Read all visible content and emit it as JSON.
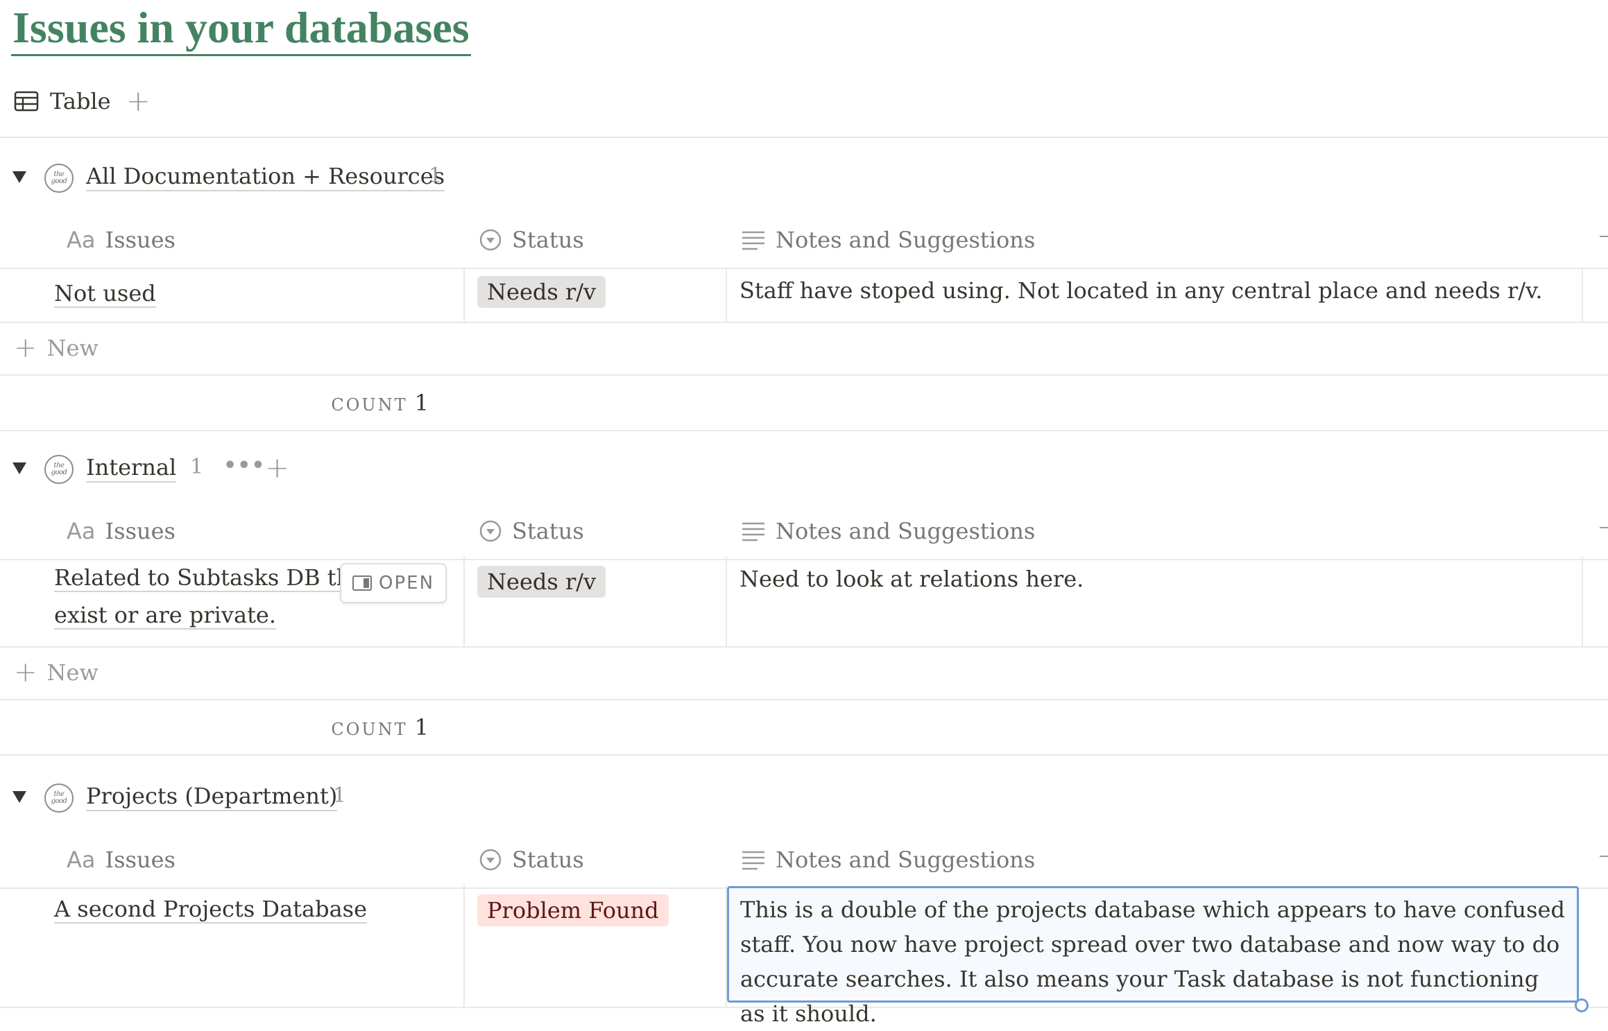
{
  "page": {
    "title": "Issues in your databases"
  },
  "view": {
    "tab_label": "Table",
    "add_label": "+"
  },
  "columns": {
    "issues": "Issues",
    "status": "Status",
    "notes": "Notes and Suggestions",
    "issues_icon": "Aa"
  },
  "groups": [
    {
      "name": "All Documentation + Resources",
      "count": "1",
      "rows": [
        {
          "issue": "Not used",
          "status": "Needs r/v",
          "notes": "Staff have stoped using. Not located in any central place and needs r/v."
        }
      ],
      "new_label": "New",
      "count_label": "COUNT",
      "count_value": "1"
    },
    {
      "name": "Internal",
      "count": "1",
      "more": "•••",
      "rows": [
        {
          "issue_line1": "Related to Subtasks DB that d",
          "issue_line2": "exist or are private.",
          "status": "Needs r/v",
          "notes": "Need to look at relations here.",
          "open_label": "OPEN"
        }
      ],
      "new_label": "New",
      "count_label": "COUNT",
      "count_value": "1"
    },
    {
      "name": "Projects (Department)",
      "count": "1",
      "rows": [
        {
          "issue": "A second Projects Database",
          "status": "Problem Found",
          "notes": "This is a double of the projects database which appears to have confused staff. You now have project spread over two database and now way to do accurate searches. It also means your Task database is not functioning as it should."
        }
      ]
    }
  ],
  "icons": {
    "group_icon": "thegood-logo-icon",
    "caret": "triangle-down-icon",
    "table": "table-icon",
    "status": "status-icon",
    "notes": "text-lines-icon",
    "plus": "plus-icon"
  },
  "colors": {
    "title": "#448361",
    "tag_gray_bg": "#e3e2e0",
    "tag_red_bg": "#ffe2dd",
    "tag_red_text": "#5d1715",
    "selection": "#6f9bd6"
  }
}
